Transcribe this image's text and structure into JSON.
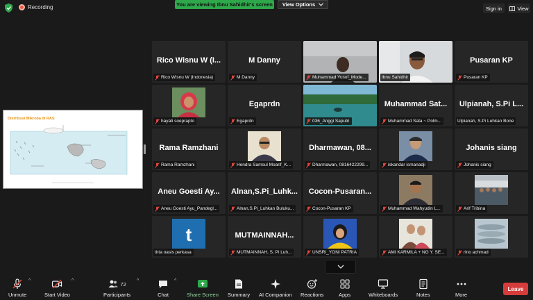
{
  "top": {
    "recording": "Recording",
    "viewing_banner": "You are viewing Ibnu Sahidhir's screen",
    "view_options": "View Options",
    "sign_in": "Sign in",
    "view": "View"
  },
  "share": {
    "title": "Distribusi Mikroba di RAS"
  },
  "tiles": [
    {
      "big": "Rico Wisnu W (I...",
      "label": "Rico Wisnu W (Indonesia)"
    },
    {
      "big": "M Danny",
      "label": "M Danny"
    },
    {
      "big": "",
      "label": "Muhammad Yusuf_Mode..."
    },
    {
      "big": "",
      "label": "Ibnu Sahidhir"
    },
    {
      "big": "Pusaran KP",
      "label": "Pusaran KP"
    },
    {
      "big": "",
      "label": "hayati soeprapto"
    },
    {
      "big": "Egaprdn",
      "label": "Egaprdn"
    },
    {
      "big": "",
      "label": "036_Anggi Saputri"
    },
    {
      "big": "Muhammad  Sat...",
      "label": "Muhammad Sata ~ Polm..."
    },
    {
      "big": "Ulpianah, S.Pi L...",
      "label": "Ulpianah, S.Pi Luhkan Bone"
    },
    {
      "big": "Rama Ramzhani",
      "label": "Rama Ramzhani"
    },
    {
      "big": "",
      "label": "Hendra Samsul Moarif_K..."
    },
    {
      "big": "Dharmawan,  08...",
      "label": "Dharmawan, 0816422299..."
    },
    {
      "big": "",
      "label": "iskandar ismanadji"
    },
    {
      "big": "Johanis siang",
      "label": "Johanis siang"
    },
    {
      "big": "Aneu Goesti  Ay...",
      "label": "Aneu Goesti Ayu_Pandegl..."
    },
    {
      "big": "Alnan,S.Pi_Luhk...",
      "label": "Alnan,S.Pi_Luhkan Buluku..."
    },
    {
      "big": "Cocon-Pusaran...",
      "label": "Cocon-Pusaran KP"
    },
    {
      "big": "",
      "label": "Muhammad Wahyudin L..."
    },
    {
      "big": "",
      "label": "Arif Tribina"
    },
    {
      "big": "",
      "label": "tirta oasis perkasa"
    },
    {
      "big": "MUTMAINNAH...",
      "label": "MUTMAINNAH, S. Pi Luh..."
    },
    {
      "big": "",
      "label": "UNSRI_YONI PATRIA"
    },
    {
      "big": "",
      "label": "AMI KARMILA + NG Y. SE..."
    },
    {
      "big": "",
      "label": "rino achmad"
    }
  ],
  "toolbar": {
    "unmute": "Unmute",
    "start_video": "Start Video",
    "participants": "Participants",
    "participants_count": "72",
    "chat": "Chat",
    "share_screen": "Share Screen",
    "summary": "Summary",
    "ai_companion": "AI Companion",
    "reactions": "Reactions",
    "apps": "Apps",
    "whiteboards": "Whiteboards",
    "notes": "Notes",
    "more": "More",
    "leave": "Leave"
  },
  "colors": {
    "accent_green": "#2ea84b",
    "leave_red": "#d63c3c",
    "active_speaker": "#b7e3ac"
  }
}
